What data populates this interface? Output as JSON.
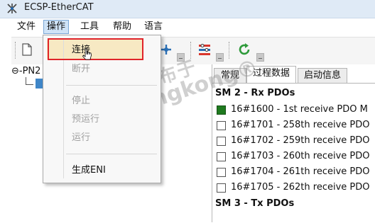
{
  "window": {
    "title": "ECSP-EtherCAT",
    "icon": "ethercat-app-icon"
  },
  "menubar": {
    "items": [
      "文件",
      "操作",
      "工具",
      "帮助",
      "语言"
    ],
    "active_index": 1
  },
  "toolbar": {
    "icons": [
      "new-document-icon",
      "network-scan-icon",
      "configure-icon",
      "refresh-icon"
    ]
  },
  "tree": {
    "root_label": "PN2"
  },
  "tabs": {
    "items": [
      "常规",
      "过程数据",
      "启动信息"
    ],
    "active_index": 1
  },
  "process_data": {
    "sections": [
      {
        "title": "SM 2 - Rx PDOs",
        "rows": [
          {
            "text": "16#1600  -  1st receive PDO M",
            "checked": true
          },
          {
            "text": "16#1701  -  258th receive PDO",
            "checked": false
          },
          {
            "text": "16#1702  -  259th receive PDO",
            "checked": false
          },
          {
            "text": "16#1703  -  260th receive PDO",
            "checked": false
          },
          {
            "text": "16#1704  -  261th receive PDO",
            "checked": false
          },
          {
            "text": "16#1705  -  262th receive PDO",
            "checked": false
          }
        ]
      },
      {
        "title": "SM 3 - Tx PDOs",
        "rows": []
      }
    ]
  },
  "operation_menu": {
    "items": [
      {
        "label": "连接",
        "enabled": true,
        "highlighted": true
      },
      {
        "label": "断开",
        "enabled": false
      },
      {
        "label": "停止",
        "enabled": false
      },
      {
        "label": "预运行",
        "enabled": false
      },
      {
        "label": "运行",
        "enabled": false
      },
      {
        "label": "生成ENI",
        "enabled": true
      }
    ]
  },
  "watermark": {
    "line1": "发布于",
    "line2": "gongkong®"
  },
  "colors": {
    "highlight_border": "#e0242a",
    "checked_box": "#1f7a1f",
    "title_bar": "#dfeaf6"
  }
}
